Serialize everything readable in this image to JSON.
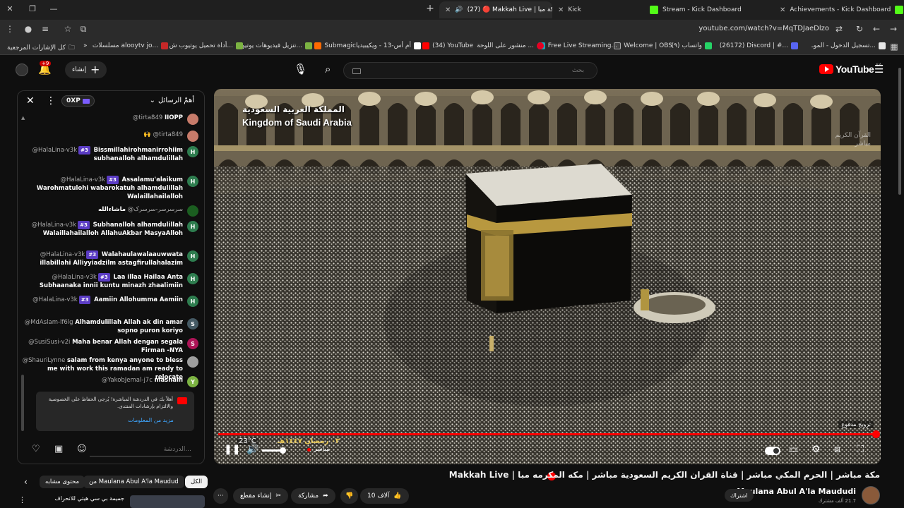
{
  "browser": {
    "tabs": [
      {
        "label": "Achievements - Kick Dashboard",
        "color": "#53fc18"
      },
      {
        "label": "Stream - Kick Dashboard",
        "color": "#53fc18"
      },
      {
        "label": "Kick",
        "color": "#53fc18"
      },
      {
        "label": "(27) 🔴 Makkah Live | مكة مبا",
        "color": "#ff0000"
      }
    ],
    "url": "youtube.com/watch?v=MqTDJaeDlzo",
    "bookmarks": [
      {
        "label": "تسجيل الدخول - الموـ...",
        "color": "#e6e6e6"
      },
      {
        "label": "(26172) Discord | #...",
        "color": "#5865f2"
      },
      {
        "label": "(٩) واتساب",
        "color": "#25d366"
      },
      {
        "label": "Welcome | OBS",
        "color": "#444444"
      },
      {
        "label": "Free Live Streaming...",
        "color": "#17a2b8"
      },
      {
        "label": "منشور على اللوحة ...",
        "color": "#e60023"
      },
      {
        "label": "(34) YouTube",
        "color": "#ff0000"
      },
      {
        "label": "أم أس-13 - ويكيبيديا",
        "color": "#ffffff"
      },
      {
        "label": "Submagic",
        "color": "#ff6a00"
      },
      {
        "label": "تنزيل فيديوهات يوتيو...",
        "color": "#7cb342"
      },
      {
        "label": "أداة تحميل يوتيوب ش...",
        "color": "#7cb342"
      },
      {
        "label": "مسلسلات alooytv jo...",
        "color": "#c62828"
      },
      {
        "label": "كل الإشارات المرجعية",
        "color": "#cccccc"
      }
    ]
  },
  "masthead": {
    "search_placeholder": "بحث",
    "logo_text": "YouTube",
    "logo_country": "SA",
    "create_label": "إنشاء",
    "notif_count": "+9"
  },
  "chat": {
    "title": "أهمّ الرسائل",
    "xp": "0XP",
    "messages": [
      {
        "author": "@tirta849",
        "text": "IIOPP",
        "badge": "",
        "avatar": "",
        "color": "#c77b6a"
      },
      {
        "author": "@tirta849",
        "text": "🙌",
        "badge": "",
        "avatar": "",
        "color": "#c77b6a"
      },
      {
        "author": "@HalaLina-v3k",
        "text": "Bissmillahirohmanirrohiim subhanalloh alhamdulillah",
        "badge": "#3",
        "avatar": "H",
        "color": "#2e7d4f"
      },
      {
        "author": "@HalaLina-v3k",
        "text": "Assalamu'alaikum Warohmatulohi wabarokatuh alhamdulillah Walaillahailalloh",
        "badge": "#3",
        "avatar": "H",
        "color": "#2e7d4f"
      },
      {
        "author": "@سرسرسر-سرسرک",
        "text": "ماشاءالله",
        "badge": "",
        "avatar": "",
        "color": "#1b5e20"
      },
      {
        "author": "@HalaLina-v3k",
        "text": "Subhanalloh alhamdulillah Walaillahailalloh AllahuAkbar MasyaAlloh",
        "badge": "#3",
        "avatar": "H",
        "color": "#2e7d4f"
      },
      {
        "author": "@HalaLina-v3k",
        "text": "Walahaulawalaauwwata illabillahi Alliyyiadzilm astagfirullahalazim",
        "badge": "#3",
        "avatar": "H",
        "color": "#2e7d4f"
      },
      {
        "author": "@HalaLina-v3k",
        "text": "Laa illaa Hailaa Anta Subhaanaka innii kuntu minazh zhaalimiin",
        "badge": "#3",
        "avatar": "H",
        "color": "#2e7d4f"
      },
      {
        "author": "@HalaLina-v3k",
        "text": "Aamiin Allohumma Aamiin",
        "badge": "#3",
        "avatar": "H",
        "color": "#2e7d4f"
      },
      {
        "author": "@MdAslam-lf6lg",
        "text": "Alhamdulillah Allah ak din amar sopno puron koriyo",
        "badge": "",
        "avatar": "S",
        "color": "#455a64"
      },
      {
        "author": "@SusiSusi-v2i",
        "text": "Maha benar Allah dengan segala Firman -NYA",
        "badge": "",
        "avatar": "S",
        "color": "#ad1457"
      },
      {
        "author": "@ShauriLynne",
        "text": "salam from kenya anyone to bless me with work this ramadan am ready to relocate",
        "badge": "",
        "avatar": "",
        "color": "#9e9e9e"
      },
      {
        "author": "@YakobJemal-j7c",
        "text": "mashalh",
        "badge": "",
        "avatar": "Y",
        "color": "#7cb342"
      }
    ],
    "banner_text": "أهلاً بك في الدردشة المباشرة! يُرجى الحفاظ على الخصوصية والالتزام بإرشادات المنتدى.",
    "banner_link": "مزيد من المعلومات",
    "input_placeholder": "الدردشة..."
  },
  "below_chat": {
    "chips": [
      "الكل",
      "من Maulana Abul A'la Maudud",
      "محتوى مشابه"
    ],
    "related_title": "جميمة بي سي هيتي للانحراف"
  },
  "video": {
    "overlay_ar": "المملكة العربية السعودية",
    "overlay_en": "Kingdom of Saudi Arabia",
    "overlay_date": "٠٣ رمضان ١٤٤٧هـ",
    "temp": "23°C",
    "corner_logo": "القرآن الكريم\nمباشر",
    "paid_promo": "ترويج مدفوع",
    "live_label": "مباشر",
    "progress": 1.0,
    "volume": 0.85
  },
  "info": {
    "title": "مكة مباشر | الحرم المكي مباشر | قناة القران الكريم السعودية مباشر | مكه المكرمه مبا | Makkah Live",
    "channel": "Maulana Abul A'la Maududi",
    "subs": "21.7 ألف مشترك",
    "subscribe_label": "اشتراك",
    "likes": "10 آلاف",
    "share_label": "مشاركة",
    "clip_label": "إنشاء مقطع"
  }
}
